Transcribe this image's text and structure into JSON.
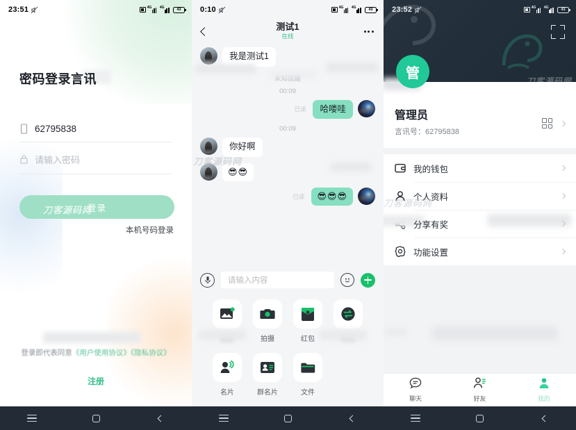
{
  "app": {
    "accent_green": "#20c997",
    "bubble_green": "#85dfc0",
    "dark_header": "#27333f"
  },
  "watermark": {
    "text": "刀客源码网"
  },
  "login": {
    "statusbar": {
      "time": "23:51",
      "battery": "43",
      "signal_label": "4G"
    },
    "title": "密码登录言讯",
    "account": {
      "icon": "phone-icon",
      "value": "62795838"
    },
    "password": {
      "icon": "lock-icon",
      "placeholder": "请输入密码",
      "value": ""
    },
    "login_button": "登录",
    "phone_login_link": "本机号码登录",
    "agreement_prefix": "登录即代表同意",
    "agreement_user": "《用户使用协议》",
    "agreement_privacy": "《隐私协议》",
    "register_link": "注册"
  },
  "chat": {
    "statusbar": {
      "time": "0:10",
      "battery": "43",
      "signal_label": "4G"
    },
    "header": {
      "back": "back-icon",
      "title": "测试1",
      "status": "在线",
      "more": "more-icon"
    },
    "messages": [
      {
        "side": "in",
        "type": "text",
        "text": "我是测试1",
        "avatar": "girl-avatar"
      },
      {
        "side": "sys",
        "type": "notice",
        "text": "未知提醒"
      },
      {
        "side": "sys",
        "type": "time",
        "text": "00:09"
      },
      {
        "side": "out",
        "type": "text",
        "text": "哈喽哇",
        "read": "已读",
        "avatar": "space-avatar"
      },
      {
        "side": "sys",
        "type": "time",
        "text": "00:09"
      },
      {
        "side": "in",
        "type": "text",
        "text": "你好啊",
        "avatar": "girl-avatar"
      },
      {
        "side": "in",
        "type": "emoji",
        "text": "😎😎",
        "avatar": "girl-avatar"
      },
      {
        "side": "out",
        "type": "emoji",
        "text": "😎😎😎",
        "read": "已读",
        "avatar": "space-avatar"
      }
    ],
    "input": {
      "mic": "mic-icon",
      "placeholder": "请输入内容",
      "emoji": "emoji-icon",
      "plus": "plus-icon"
    },
    "panel_items": [
      {
        "label": "相册",
        "icon": "image-icon",
        "blurred": true
      },
      {
        "label": "拍摄",
        "icon": "camera-icon",
        "blurred": false
      },
      {
        "label": "红包",
        "icon": "redpacket-icon",
        "blurred": false
      },
      {
        "label": "转账",
        "icon": "transfer-icon",
        "blurred": true
      },
      {
        "label": "名片",
        "icon": "contact-icon",
        "blurred": false
      },
      {
        "label": "群名片",
        "icon": "groupcard-icon",
        "blurred": false
      },
      {
        "label": "文件",
        "icon": "folder-icon",
        "blurred": false
      }
    ]
  },
  "profile": {
    "statusbar": {
      "time": "23:52",
      "battery": "43",
      "signal_label": "4G"
    },
    "scan_icon": "scan-icon",
    "avatar_text": "管",
    "name": "管理员",
    "id_label": "言讯号：",
    "id_value": "62795838",
    "qr_icon": "qrcode-icon",
    "menu": [
      {
        "label": "我的钱包",
        "icon": "wallet-icon",
        "blurred": false
      },
      {
        "label": "个人资料",
        "icon": "person-icon",
        "blurred": false
      },
      {
        "label": "分享有奖",
        "icon": "share-icon",
        "blurred": true
      },
      {
        "label": "功能设置",
        "icon": "settings-icon",
        "blurred": false
      }
    ],
    "tabs": [
      {
        "label": "聊天",
        "icon": "chat-icon",
        "active": false
      },
      {
        "label": "好友",
        "icon": "friends-icon",
        "active": false
      },
      {
        "label": "我的",
        "icon": "profile-icon",
        "active": true
      }
    ]
  }
}
